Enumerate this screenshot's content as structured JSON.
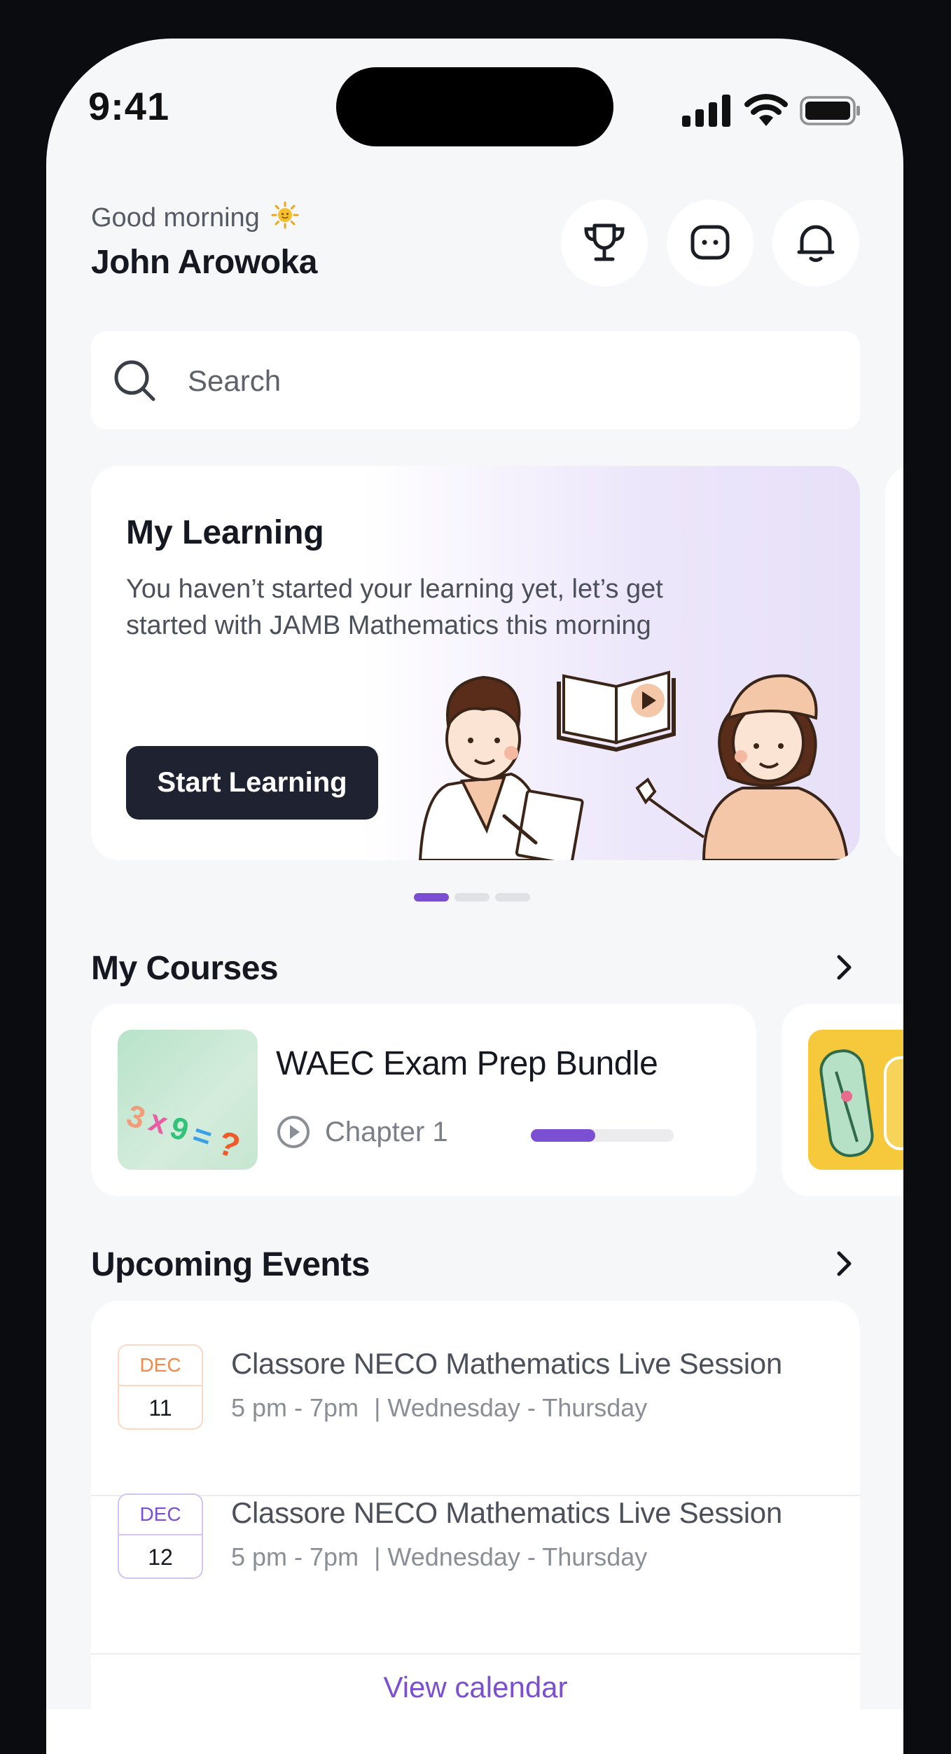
{
  "status_bar": {
    "time": "9:41"
  },
  "header": {
    "greeting": "Good morning",
    "greeting_emoji": "sun-icon",
    "name": "John Arowoka",
    "actions": [
      "trophy-icon",
      "chat-icon",
      "bell-icon"
    ]
  },
  "search": {
    "placeholder": "Search"
  },
  "hero": {
    "title": "My Learning",
    "text": "You haven’t started your learning yet, let’s get started with JAMB Mathematics this morning",
    "button": "Start Learning",
    "pager": {
      "count": 3,
      "active": 0
    }
  },
  "courses": {
    "title": "My Courses",
    "items": [
      {
        "title": "WAEC Exam Prep Bundle",
        "chapter": "Chapter 1",
        "progress": 0.45
      }
    ]
  },
  "events": {
    "title": "Upcoming Events",
    "items": [
      {
        "month": "DEC",
        "day": "11",
        "title": "Classore NECO Mathematics Live Session",
        "time": "5 pm - 7pm",
        "days": "| Wednesday - Thursday",
        "color": "#f0894a"
      },
      {
        "month": "DEC",
        "day": "12",
        "title": "Classore NECO Mathematics Live Session",
        "time": "5 pm - 7pm",
        "days": "| Wednesday - Thursday",
        "color": "#7b4fd1"
      }
    ],
    "view_calendar": "View calendar"
  },
  "colors": {
    "accent": "#7b4fd1",
    "dark_button": "#1f2230",
    "background": "#f6f7f9"
  }
}
